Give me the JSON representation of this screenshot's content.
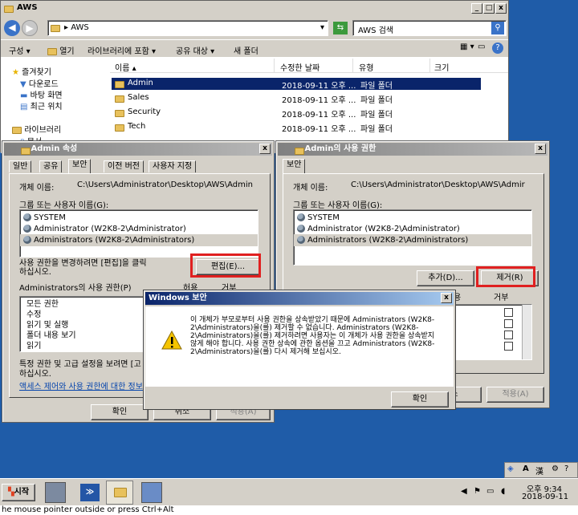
{
  "explorer": {
    "title": "AWS",
    "address": "AWS",
    "search_placeholder": "AWS 검색",
    "toolbar": [
      "구성",
      "열기",
      "라이브러리에 포함",
      "공유 대상",
      "새 폴더"
    ],
    "nav_favorites": "즐겨찾기",
    "nav_items": [
      "다운로드",
      "바탕 화면",
      "최근 위치"
    ],
    "nav_libraries": "라이브러리",
    "nav_partial": "문서",
    "columns": [
      "이름",
      "수정한 날짜",
      "유형",
      "크기"
    ],
    "files": [
      {
        "name": "Admin",
        "date": "2018-09-11 오후 ...",
        "type": "파일 폴더"
      },
      {
        "name": "Sales",
        "date": "2018-09-11 오후 ...",
        "type": "파일 폴더"
      },
      {
        "name": "Security",
        "date": "2018-09-11 오후 ...",
        "type": "파일 폴더"
      },
      {
        "name": "Tech",
        "date": "2018-09-11 오후 ...",
        "type": "파일 폴더"
      }
    ]
  },
  "props": {
    "title": "Admin 속성",
    "tabs": [
      "일반",
      "공유",
      "보안",
      "이전 버전",
      "사용자 지정"
    ],
    "object_label": "개체 이름:",
    "object_path": "C:\\Users\\Administrator\\Desktop\\AWS\\Admin",
    "group_label": "그룹 또는 사용자 이름(G):",
    "users": [
      "SYSTEM",
      "Administrator (W2K8-2\\Administrator)",
      "Administrators (W2K8-2\\Administrators)"
    ],
    "change_hint": "사용 권한을 변경하려면 [편집]을 클릭하십시오.",
    "edit_button": "편집(E)...",
    "perm_label": "Administrators의 사용 권한(P)",
    "allow": "허용",
    "deny": "거부",
    "perms": [
      "모든 권한",
      "수정",
      "읽기 및 실행",
      "폴더 내용 보기",
      "읽기"
    ],
    "special_hint": "특정 권한 및 고급 설정을 보려면 [고",
    "special_hint2": "하십시오.",
    "link": "액세스 제어와 사용 권한에 대한 정보",
    "ok": "확인",
    "cancel": "취소",
    "apply": "적용(A)"
  },
  "perm_win": {
    "title": "Admin의 사용 권한",
    "tab": "보안",
    "object_label": "개체 이름:",
    "object_path": "C:\\Users\\Administrator\\Desktop\\AWS\\Admir",
    "group_label": "그룹 또는 사용자 이름(G):",
    "users": [
      "SYSTEM",
      "Administrator (W2K8-2\\Administrator)",
      "Administrators (W2K8-2\\Administrators)"
    ],
    "add_button": "추가(D)...",
    "remove_button": "제거(R)",
    "allow_partial": "용",
    "deny": "거부",
    "cancel_partial": "소",
    "apply": "적용(A)"
  },
  "dialog": {
    "title": "Windows 보안",
    "message": "이 개체가 부모로부터 사용 권한을 상속받았기 때문에 Administrators (W2K8-2\\Administrators)을(를) 제거할 수 없습니다. Administrators (W2K8-2\\Administrators)을(를) 제거하려면 사용자는 이 개체가 사용 권한을 상속받지 않게 해야 합니다. 사용 권한 상속에 관한 옵션을 끄고 Administrators (W2K8-2\\Administrators)을(를) 다시 제거해 보십시오.",
    "ok": "확인"
  },
  "taskbar": {
    "start": "시작",
    "time": "오후 9:34",
    "date": "2018-09-11",
    "lang_a": "A",
    "lang_han": "漢"
  },
  "bottom_hint": "he mouse pointer outside or press Ctrl+Alt"
}
